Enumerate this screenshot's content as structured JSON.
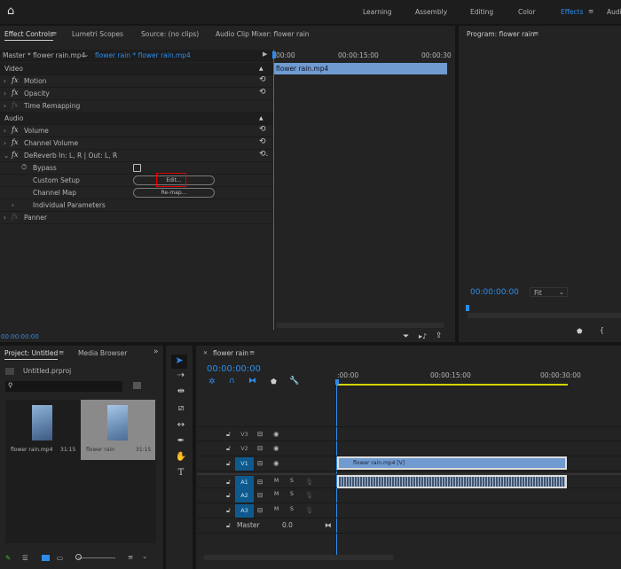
{
  "header": {
    "workspaces": [
      "Learning",
      "Assembly",
      "Editing",
      "Color",
      "Effects",
      "Audi"
    ],
    "active": "Effects"
  },
  "effect_panel": {
    "tabs": [
      "Effect Controls",
      "Lumetri Scopes",
      "Source: (no clips)",
      "Audio Clip Mixer: flower rain"
    ],
    "master": "Master * flower rain.mp4",
    "clip": "flower rain * flower rain.mp4",
    "ruler": [
      "00:00",
      "00:00:15:00",
      "00:00:30"
    ],
    "clip_bar": "flower rain.mp4",
    "sections": {
      "video": "Video",
      "audio": "Audio"
    },
    "effects": {
      "motion": "Motion",
      "opacity": "Opacity",
      "time_remap": "Time Remapping",
      "volume": "Volume",
      "channel_volume": "Channel Volume",
      "dereverb": "DeReverb In: L, R | Out: L, R",
      "bypass": "Bypass",
      "custom_setup": "Custom Setup",
      "channel_map": "Channel Map",
      "individual": "Individual Parameters",
      "panner": "Panner"
    },
    "edit_button": "Edit...",
    "remap_button": "Re-map...",
    "timecode": "00:00:00:00"
  },
  "program": {
    "title": "Program: flower rain",
    "timecode": "00:00:00:00",
    "fit": "Fit"
  },
  "project": {
    "tabs": [
      "Project: Untitled",
      "Media Browser"
    ],
    "file": "Untitled.prproj",
    "search_placeholder": "",
    "items": [
      {
        "name": "flower rain.mp4",
        "duration": "31:15"
      },
      {
        "name": "flower rain",
        "duration": "31:15"
      }
    ]
  },
  "timeline": {
    "title": "flower rain",
    "timecode": "00:00:00:00",
    "ruler": [
      ":00:00",
      "00:00:15:00",
      "00:00:30:00"
    ],
    "tracks": {
      "v3": "V3",
      "v2": "V2",
      "v1": "V1",
      "a1": "A1",
      "a2": "A2",
      "a3": "A3",
      "m": "M",
      "s": "S",
      "master": "Master",
      "master_val": "0.0"
    },
    "video_clip": "flower rain.mp4 [V]"
  },
  "colors": {
    "accent": "#2d8ceb",
    "clip_video": "#6f9bd1",
    "work_area": "#d4d400",
    "highlight": "#e00000"
  }
}
